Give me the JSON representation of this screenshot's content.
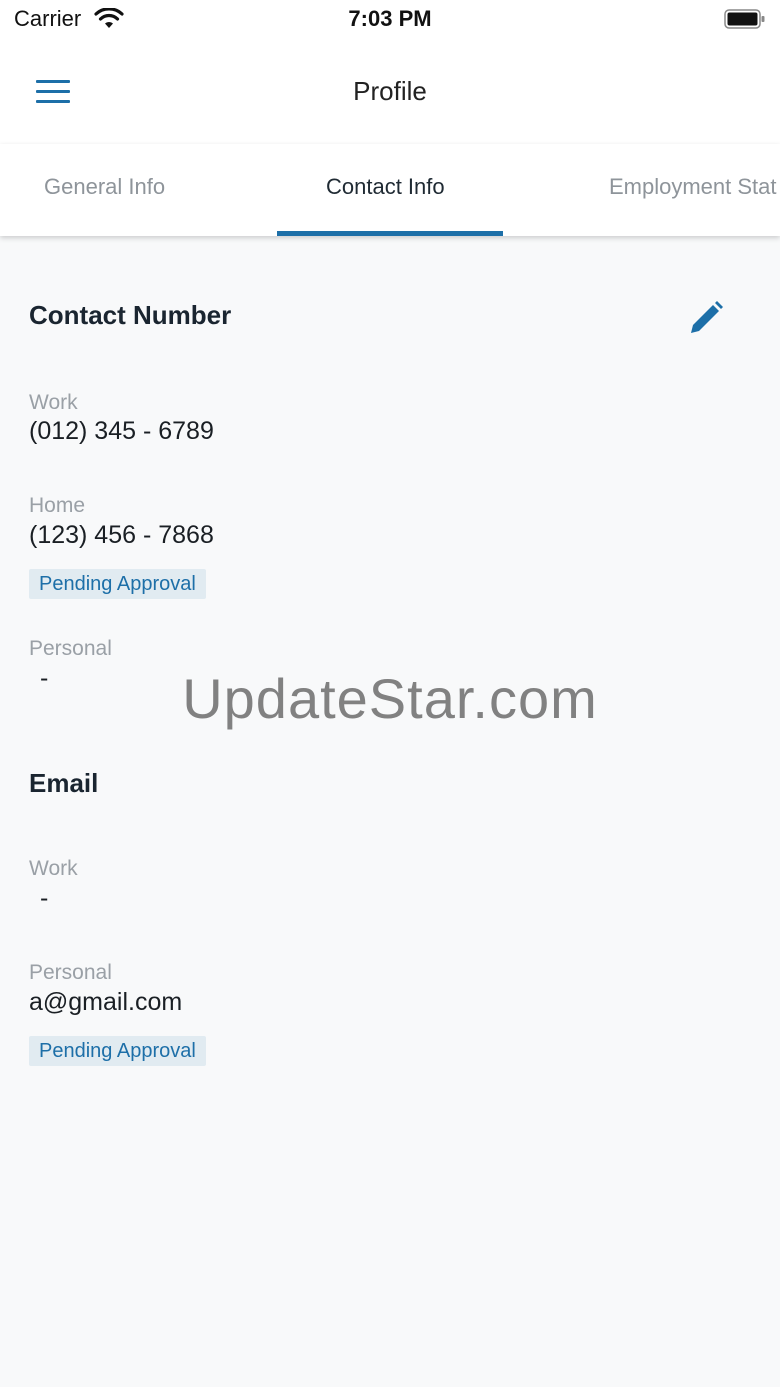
{
  "status_bar": {
    "carrier": "Carrier",
    "time": "7:03 PM"
  },
  "header": {
    "title": "Profile",
    "menu_icon": "hamburger-icon"
  },
  "tabs": [
    {
      "label": "General Info",
      "active": false
    },
    {
      "label": "Contact Info",
      "active": true
    },
    {
      "label": "Employment Stat",
      "active": false
    }
  ],
  "contact_number": {
    "title": "Contact Number",
    "edit_icon": "pencil-icon",
    "work": {
      "label": "Work",
      "value": "(012) 345 - 6789"
    },
    "home": {
      "label": "Home",
      "value": "(123) 456 - 7868",
      "badge": "Pending Approval"
    },
    "personal": {
      "label": "Personal",
      "value": "-"
    }
  },
  "email": {
    "title": "Email",
    "work": {
      "label": "Work",
      "value": "-"
    },
    "personal": {
      "label": "Personal",
      "value": "a@gmail.com",
      "badge": "Pending Approval"
    }
  },
  "watermark": "UpdateStar.com",
  "colors": {
    "accent": "#1d6fa8",
    "background": "#f8f9fa",
    "badge_bg": "#e1ebf1"
  }
}
